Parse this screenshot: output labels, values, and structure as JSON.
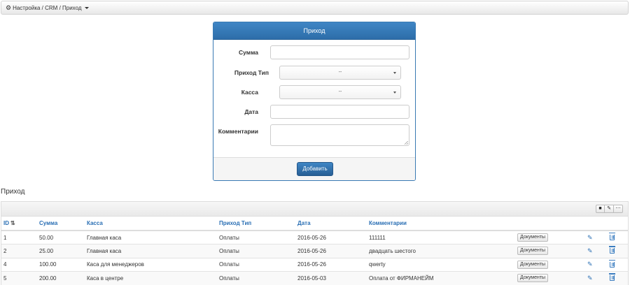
{
  "breadcrumb": {
    "text": "Настройка / CRM / Приход",
    "icon": "gear-icon"
  },
  "form": {
    "title": "Приход",
    "fields": {
      "amount_label": "Сумма",
      "amount_value": "",
      "type_label": "Приход Тип",
      "type_selected": "--",
      "cash_label": "Касса",
      "cash_selected": "--",
      "date_label": "Дата",
      "date_value": "",
      "comment_label": "Комментарии",
      "comment_value": ""
    },
    "submit_label": "Добавить"
  },
  "section_title": "Приход",
  "toolbar": {
    "icons": [
      "person-icon",
      "wrench-icon",
      "more-icon"
    ]
  },
  "table": {
    "columns": [
      "ID",
      "Сумма",
      "Касса",
      "Приход Тип",
      "Дата",
      "Комментарии"
    ],
    "doc_label": "Документы",
    "rows": [
      {
        "id": "1",
        "amount": "50.00",
        "cash": "Главная каса",
        "type": "Оплаты",
        "date": "2016-05-26",
        "comment": "111111"
      },
      {
        "id": "2",
        "amount": "25.00",
        "cash": "Главная каса",
        "type": "Оплаты",
        "date": "2016-05-26",
        "comment": "двадцать шестого"
      },
      {
        "id": "4",
        "amount": "100.00",
        "cash": "Каса для менеджеров",
        "type": "Оплаты",
        "date": "2016-05-26",
        "comment": "qwerty"
      },
      {
        "id": "5",
        "amount": "200.00",
        "cash": "Каса в центре",
        "type": "Оплаты",
        "date": "2016-05-03",
        "comment": "Оплата от ФИРМАНЕЙМ"
      }
    ]
  },
  "colors": {
    "accent": "#3277b7",
    "link": "#2a6fb4"
  }
}
